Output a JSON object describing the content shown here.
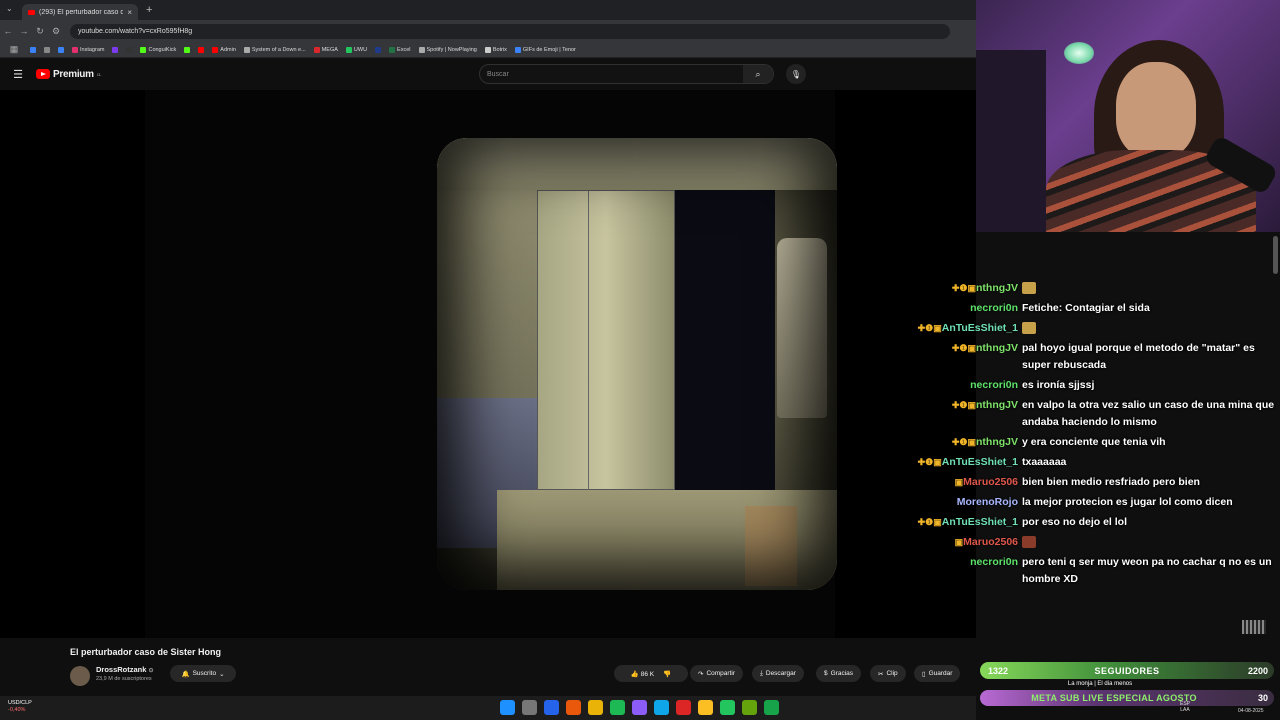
{
  "browser": {
    "tab_title": "(293) El perturbador caso d",
    "close_glyph": "×",
    "new_tab_glyph": "+",
    "tab_menu_glyph": "⌄",
    "url": "youtube.com/watch?v=cxRo595fH8g",
    "bookmarks": [
      {
        "label": "",
        "color": "#3b82f6"
      },
      {
        "label": "",
        "color": "#888888"
      },
      {
        "label": "",
        "color": "#3b82f6"
      },
      {
        "label": "Instagram",
        "color": "#e1306c"
      },
      {
        "label": "",
        "color": "#7c3aed"
      },
      {
        "label": "",
        "color": "#333333"
      },
      {
        "label": "ConguiKick",
        "color": "#53fc18"
      },
      {
        "label": "",
        "color": "#53fc18"
      },
      {
        "label": "",
        "color": "#ff0000"
      },
      {
        "label": "Admin",
        "color": "#ff0000"
      },
      {
        "label": "System of a Down e...",
        "color": "#aaaaaa"
      },
      {
        "label": "MEGA",
        "color": "#d9272e"
      },
      {
        "label": "UWU",
        "color": "#22c55e"
      },
      {
        "label": "",
        "color": "#1e3a8a"
      },
      {
        "label": "Excel",
        "color": "#217346"
      },
      {
        "label": "Spotify | NowPlaying",
        "color": "#aaaaaa"
      },
      {
        "label": "Botrix",
        "color": "#cccccc"
      },
      {
        "label": "GIFs de Emoji | Tenor",
        "color": "#3b82f6"
      }
    ]
  },
  "youtube": {
    "logo_text": "Premium",
    "logo_region": "CL",
    "search_placeholder": "Buscar",
    "video_title": "El perturbador caso de Sister Hong",
    "channel_name": "DrossRotzank",
    "verified_glyph": "⊙",
    "subscribers": "23,9 M de suscriptores",
    "subscribe_label": "Suscrito",
    "actions": {
      "likes": "86 K",
      "share": "Compartir",
      "download": "Descargar",
      "thanks": "Gracias",
      "clip": "Clip",
      "save": "Guardar"
    }
  },
  "chat": [
    {
      "badges": "✚❶▣",
      "user": "nthngJV",
      "color": "#7fe36a",
      "text": "",
      "emote": true,
      "emote_style": ""
    },
    {
      "badges": "",
      "user": "necrori0n",
      "color": "#5ee36a",
      "text": "Fetiche: Contagiar el sida",
      "emote": false,
      "emote_style": ""
    },
    {
      "badges": "✚❶▣",
      "user": "AnTuEsShiet_1",
      "color": "#6fe0b4",
      "text": "",
      "emote": true,
      "emote_style": ""
    },
    {
      "badges": "✚❶▣",
      "user": "nthngJV",
      "color": "#7fe36a",
      "text": "pal hoyo igual porque el metodo de \"matar\" es super rebuscada",
      "emote": false,
      "emote_style": ""
    },
    {
      "badges": "",
      "user": "necrori0n",
      "color": "#5ee36a",
      "text": "es ironía sjjssj",
      "emote": false,
      "emote_style": ""
    },
    {
      "badges": "✚❶▣",
      "user": "nthngJV",
      "color": "#7fe36a",
      "text": "en valpo la otra vez salio un caso de una mina que andaba haciendo lo mismo",
      "emote": false,
      "emote_style": ""
    },
    {
      "badges": "✚❶▣",
      "user": "nthngJV",
      "color": "#7fe36a",
      "text": "y era conciente que tenia vih",
      "emote": false,
      "emote_style": ""
    },
    {
      "badges": "✚❶▣",
      "user": "AnTuEsShiet_1",
      "color": "#6fe0b4",
      "text": "txaaaaaa",
      "emote": false,
      "emote_style": ""
    },
    {
      "badges": "▣",
      "user": "Maruo2506",
      "color": "#e0574c",
      "text": "bien bien medio resfriado pero bien",
      "emote": false,
      "emote_style": ""
    },
    {
      "badges": "",
      "user": "MorenoRojo",
      "color": "#a8b7ff",
      "text": "la mejor protecion es jugar lol como dicen",
      "emote": false,
      "emote_style": ""
    },
    {
      "badges": "✚❶▣",
      "user": "AnTuEsShiet_1",
      "color": "#6fe0b4",
      "text": "por eso no dejo el lol",
      "emote": false,
      "emote_style": ""
    },
    {
      "badges": "▣",
      "user": "Maruo2506",
      "color": "#e0574c",
      "text": "",
      "emote": true,
      "emote_style": "red"
    },
    {
      "badges": "",
      "user": "necrori0n",
      "color": "#5ee36a",
      "text": "pero teni q ser muy weon pa no cachar q no es un hombre XD",
      "emote": false,
      "emote_style": ""
    }
  ],
  "goals": {
    "followers_current": "1322",
    "followers_label": "SEGUIDORES",
    "followers_target": "2200",
    "followers_progress": 0.6,
    "now_playing": "La monja | El dia menos",
    "sub_label": "META SUB LIVE ESPECIAL AGOSTO",
    "sub_target": "30"
  },
  "taskbar": {
    "ticker_name": "USD/CLP",
    "ticker_change": "-0,40%",
    "tray_lang": "ESP",
    "tray_region": "LAA",
    "date": "04-08-2025",
    "apps": [
      "#1e90ff",
      "#777777",
      "#2563eb",
      "#ea580c",
      "#eab308",
      "#1db954",
      "#8b5cf6",
      "#0ea5e9",
      "#dc2626",
      "#fbbf24",
      "#22c55e",
      "#65a30d",
      "#16a34a"
    ]
  }
}
